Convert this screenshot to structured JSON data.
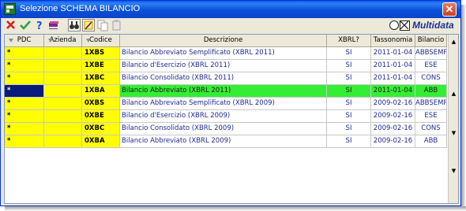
{
  "window": {
    "title": "Selezione SCHEMA BILANCIO",
    "close_glyph": "✕"
  },
  "toolbar": {
    "items": [
      {
        "icon": "cancel-x-icon",
        "color": "#d61f1f"
      },
      {
        "icon": "confirm-check-icon",
        "color": "#2ea043"
      },
      {
        "icon": "help-question-icon",
        "color": "#1f4fd8"
      },
      {
        "icon": "books-icon",
        "color": "#7a2a8a"
      },
      {
        "icon": "binoculars-icon",
        "color": "#333333"
      },
      {
        "icon": "edit-table-icon",
        "color": "#c89a00"
      },
      {
        "icon": "copy-icon",
        "color": "#a0a0a0"
      },
      {
        "icon": "paste-icon",
        "color": "#a0a0a0"
      }
    ],
    "brand": "Multidata"
  },
  "grid": {
    "headers": {
      "pdc": "PDC",
      "azienda": "Azienda",
      "codice": "Codice",
      "descrizione": "Descrizione",
      "xbrl": "XBRL?",
      "tassonomia": "Tassonomia",
      "bilancio": "Bilancio"
    },
    "rows": [
      {
        "pdc": "*",
        "azienda": "",
        "codice": "1XBS",
        "descrizione": "Bilancio Abbreviato Semplificato (XBRL 2011)",
        "xbrl": "SI",
        "tassonomia": "2011-01-04",
        "bilancio": "ABBSEMP"
      },
      {
        "pdc": "*",
        "azienda": "",
        "codice": "1XBE",
        "descrizione": "Bilancio d'Esercizio (XBRL 2011)",
        "xbrl": "SI",
        "tassonomia": "2011-01-04",
        "bilancio": "ESE"
      },
      {
        "pdc": "*",
        "azienda": "",
        "codice": "1XBC",
        "descrizione": "Bilancio Consolidato (XBRL 2011)",
        "xbrl": "SI",
        "tassonomia": "2011-01-04",
        "bilancio": "CONS"
      },
      {
        "pdc": "*",
        "azienda": "",
        "codice": "1XBA",
        "descrizione": "Bilancio Abbreviato (XBRL 2011)",
        "xbrl": "SI",
        "tassonomia": "2011-01-04",
        "bilancio": "ABB",
        "selected": true
      },
      {
        "pdc": "*",
        "azienda": "",
        "codice": "0XBS",
        "descrizione": "Bilancio Abbreviato Semplificato (XBRL 2009)",
        "xbrl": "SI",
        "tassonomia": "2009-02-16",
        "bilancio": "ABBSEMP"
      },
      {
        "pdc": "*",
        "azienda": "",
        "codice": "0XBE",
        "descrizione": "Bilancio d'Esercizio (XBRL 2009)",
        "xbrl": "SI",
        "tassonomia": "2009-02-16",
        "bilancio": "ESE"
      },
      {
        "pdc": "*",
        "azienda": "",
        "codice": "0XBC",
        "descrizione": "Bilancio Consolidato (XBRL 2009)",
        "xbrl": "SI",
        "tassonomia": "2009-02-16",
        "bilancio": "CONS"
      },
      {
        "pdc": "*",
        "azienda": "",
        "codice": "0XBA",
        "descrizione": "Bilancio Abbreviato (XBRL 2009)",
        "xbrl": "SI",
        "tassonomia": "2009-02-16",
        "bilancio": "ABB"
      }
    ],
    "scrollbar": {
      "up": "▲",
      "page_up": "▲",
      "page_down": "▼",
      "down": "▼"
    }
  },
  "colors": {
    "pdc_cell": "#ffff00",
    "selected_row": "#33ee33",
    "selected_cell": "#0a1a7a",
    "text_blue": "#1f2b91"
  }
}
